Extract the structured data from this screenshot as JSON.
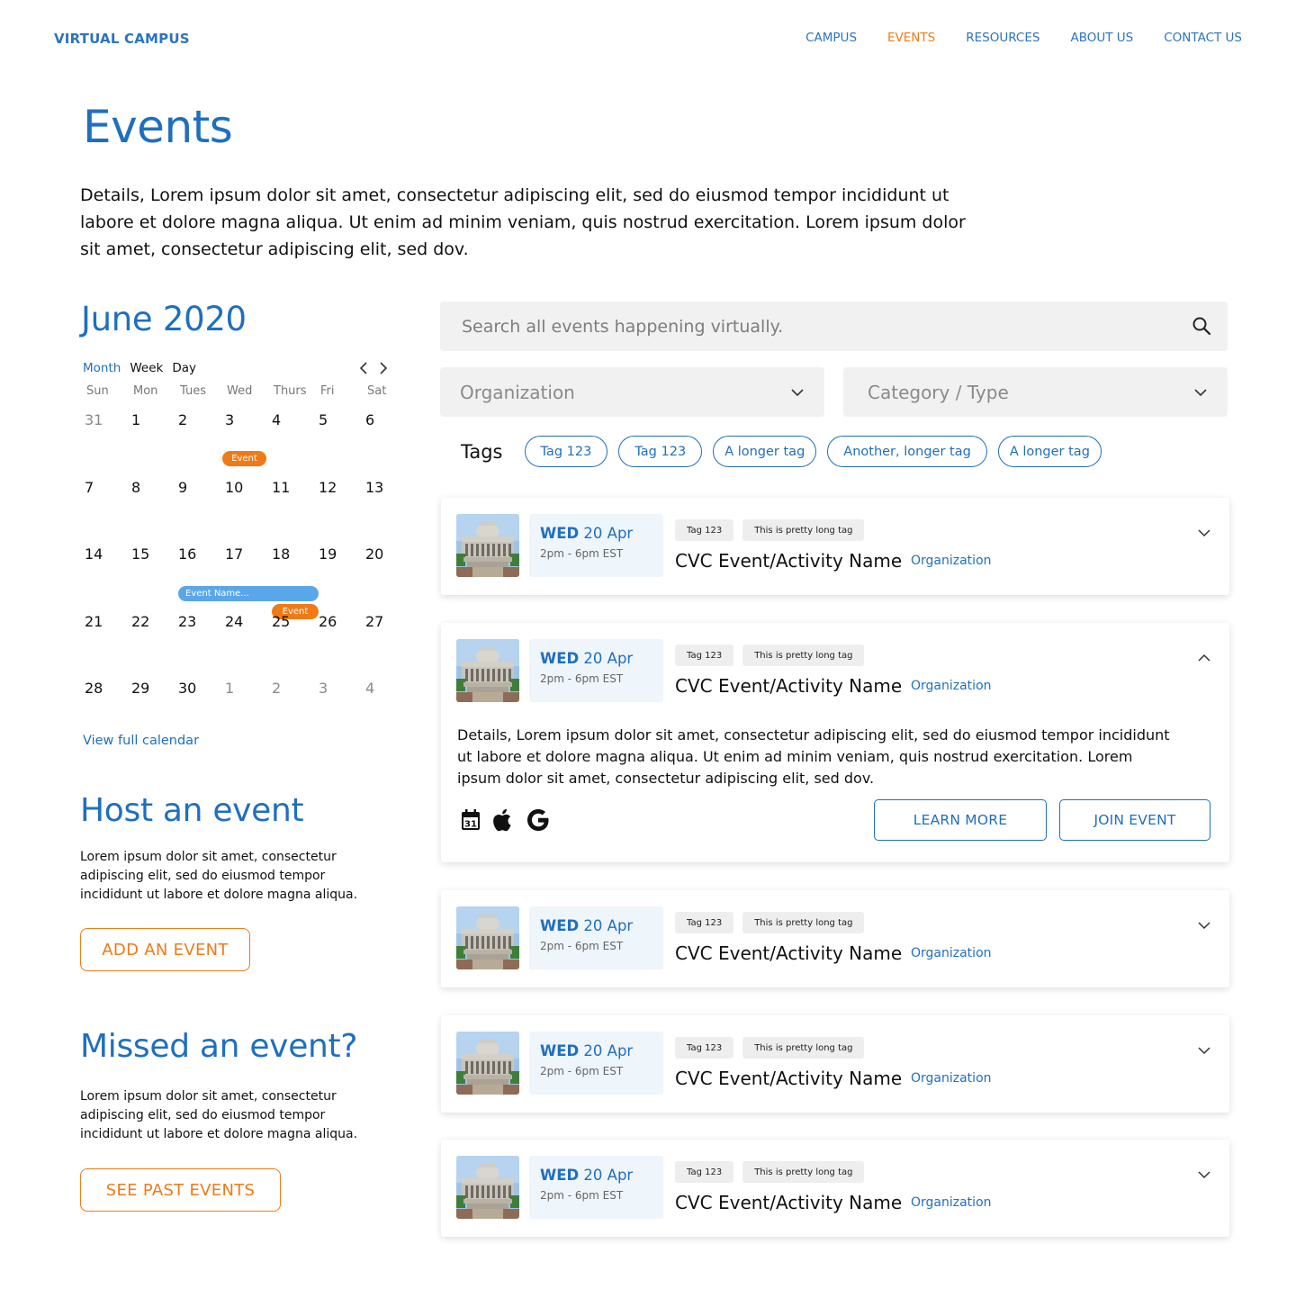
{
  "header": {
    "logo": "VIRTUAL CAMPUS",
    "nav": [
      "CAMPUS",
      "EVENTS",
      "RESOURCES",
      "ABOUT US",
      "CONTACT US"
    ],
    "active_nav": "EVENTS"
  },
  "page": {
    "title": "Events",
    "intro": "Details, Lorem ipsum dolor sit amet, consectetur adipiscing elit, sed do eiusmod tempor incididunt ut labore et dolore magna aliqua. Ut enim ad minim veniam, quis nostrud exercitation. Lorem ipsum dolor sit amet, consectetur adipiscing elit, sed dov."
  },
  "calendar": {
    "title": "June 2020",
    "views": [
      "Month",
      "Week",
      "Day"
    ],
    "selected_view": "Month",
    "weekdays": [
      "Sun",
      "Mon",
      "Tues",
      "Wed",
      "Thurs",
      "Fri",
      "Sat"
    ],
    "weeks": [
      [
        {
          "d": "31",
          "m": true
        },
        {
          "d": "1"
        },
        {
          "d": "2"
        },
        {
          "d": "3"
        },
        {
          "d": "4"
        },
        {
          "d": "5"
        },
        {
          "d": "6"
        }
      ],
      [
        {
          "d": "7"
        },
        {
          "d": "8"
        },
        {
          "d": "9"
        },
        {
          "d": "10"
        },
        {
          "d": "11"
        },
        {
          "d": "12"
        },
        {
          "d": "13"
        }
      ],
      [
        {
          "d": "14"
        },
        {
          "d": "15"
        },
        {
          "d": "16"
        },
        {
          "d": "17"
        },
        {
          "d": "18"
        },
        {
          "d": "19"
        },
        {
          "d": "20"
        }
      ],
      [
        {
          "d": "21"
        },
        {
          "d": "22"
        },
        {
          "d": "23"
        },
        {
          "d": "24"
        },
        {
          "d": "25"
        },
        {
          "d": "26"
        },
        {
          "d": "27"
        }
      ],
      [
        {
          "d": "28"
        },
        {
          "d": "29"
        },
        {
          "d": "30"
        },
        {
          "d": "1",
          "m": true
        },
        {
          "d": "2",
          "m": true
        },
        {
          "d": "3",
          "m": true
        },
        {
          "d": "4",
          "m": true
        }
      ]
    ],
    "events": {
      "wed3": "Event",
      "span16to18": "Event Name...",
      "thu18": "Event"
    },
    "view_full": "View full calendar"
  },
  "host": {
    "title": "Host an event",
    "text": "Lorem ipsum dolor sit amet, consectetur adipiscing elit, sed do eiusmod tempor incididunt ut labore et dolore magna aliqua.",
    "button": "ADD AN EVENT"
  },
  "missed": {
    "title": "Missed an event?",
    "text": "Lorem ipsum dolor sit amet, consectetur adipiscing elit, sed do eiusmod tempor incididunt ut labore et dolore magna aliqua.",
    "button": "SEE PAST EVENTS"
  },
  "search": {
    "placeholder": "Search all events happening virtually."
  },
  "filters": {
    "organization": "Organization",
    "category": "Category / Type"
  },
  "tags": {
    "label": "Tags",
    "items": [
      "Tag 123",
      "Tag 123",
      "A longer tag",
      "Another, longer tag",
      "A longer tag"
    ]
  },
  "events": [
    {
      "day": "WED",
      "date": "20 Apr",
      "time": "2pm - 6pm EST",
      "tags": [
        "Tag 123",
        "This is pretty long tag"
      ],
      "name": "CVC Event/Activity Name",
      "org": "Organization"
    },
    {
      "day": "WED",
      "date": "20 Apr",
      "time": "2pm - 6pm EST",
      "tags": [
        "Tag 123",
        "This is pretty long tag"
      ],
      "name": "CVC Event/Activity Name",
      "org": "Organization",
      "details": "Details, Lorem ipsum dolor sit amet, consectetur adipiscing elit, sed do eiusmod tempor incididunt ut labore et dolore magna aliqua. Ut enim ad minim veniam, quis nostrud exercitation. Lorem ipsum dolor sit amet, consectetur adipiscing elit, sed dov.",
      "cal_icon_day": "31",
      "learn": "LEARN MORE",
      "join": "JOIN EVENT"
    },
    {
      "day": "WED",
      "date": "20 Apr",
      "time": "2pm - 6pm EST",
      "tags": [
        "Tag 123",
        "This is pretty long tag"
      ],
      "name": "CVC Event/Activity Name",
      "org": "Organization"
    },
    {
      "day": "WED",
      "date": "20 Apr",
      "time": "2pm - 6pm EST",
      "tags": [
        "Tag 123",
        "This is pretty long tag"
      ],
      "name": "CVC Event/Activity Name",
      "org": "Organization"
    },
    {
      "day": "WED",
      "date": "20 Apr",
      "time": "2pm - 6pm EST",
      "tags": [
        "Tag 123",
        "This is pretty long tag"
      ],
      "name": "CVC Event/Activity Name",
      "org": "Organization"
    }
  ],
  "colors": {
    "brand_blue": "#1f6fbf",
    "accent_orange": "#f07a16",
    "event_blue": "#5aa6ea"
  },
  "icons": [
    "search-icon",
    "chevron-down-icon",
    "chevron-up-icon",
    "chevron-left-icon",
    "chevron-right-icon",
    "calendar-icon",
    "apple-icon",
    "google-icon"
  ]
}
